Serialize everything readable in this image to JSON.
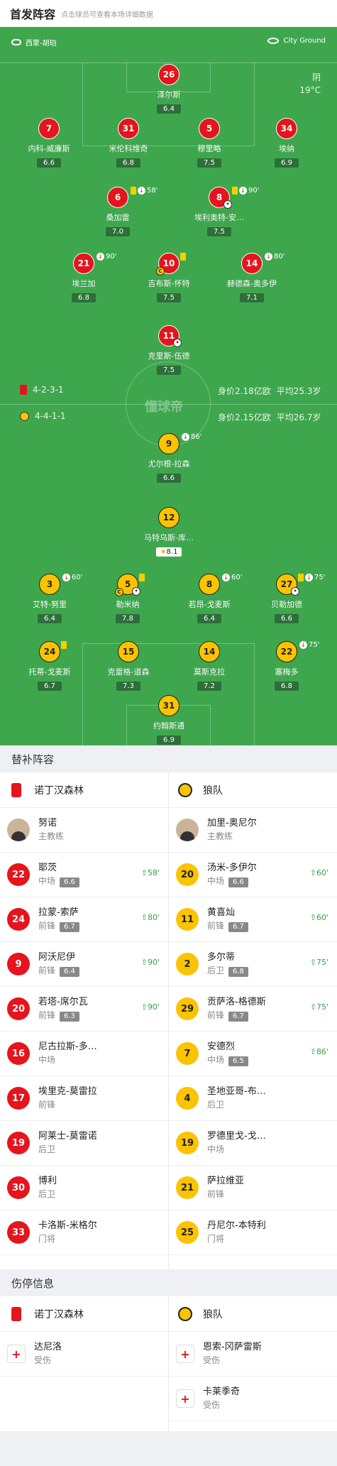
{
  "header": {
    "title": "首发阵容",
    "subtitle": "点击球员可查看本场详细数据"
  },
  "venue": {
    "left": "西蒙-胡珀",
    "right": "City Ground"
  },
  "weather": {
    "condition": "阴",
    "temperature": "19°C"
  },
  "home_team": {
    "formation": "4-2-3-1",
    "value": "身价2.18亿欧",
    "avg_age": "平均25.3岁"
  },
  "away_team": {
    "formation": "4-4-1-1",
    "value": "身价2.15亿欧",
    "avg_age": "平均26.7岁"
  },
  "home_players": [
    {
      "num": "26",
      "name": "泽尔斯",
      "rating": "6.4"
    },
    {
      "num": "7",
      "name": "内科-威廉斯",
      "rating": "6.6"
    },
    {
      "num": "31",
      "name": "米伦科维奇",
      "rating": "6.8"
    },
    {
      "num": "5",
      "name": "穆里略",
      "rating": "7.5"
    },
    {
      "num": "34",
      "name": "埃纳",
      "rating": "6.9"
    },
    {
      "num": "6",
      "name": "桑加雷",
      "rating": "7.0",
      "sub": "58'"
    },
    {
      "num": "8",
      "name": "埃利奥特-安…",
      "rating": "7.5",
      "sub": "90'"
    },
    {
      "num": "21",
      "name": "埃兰加",
      "rating": "6.8",
      "sub": "90'"
    },
    {
      "num": "10",
      "name": "吉布斯-怀特",
      "rating": "7.5"
    },
    {
      "num": "14",
      "name": "赫德森-奥多伊",
      "rating": "7.1",
      "sub": "80'"
    },
    {
      "num": "11",
      "name": "克里斯-伍德",
      "rating": "7.5"
    }
  ],
  "away_players": [
    {
      "num": "9",
      "name": "尤尔根-拉森",
      "rating": "6.6",
      "sub": "86'"
    },
    {
      "num": "12",
      "name": "马特乌斯-库…",
      "rating": "8.1"
    },
    {
      "num": "3",
      "name": "艾特-努里",
      "rating": "6.4",
      "sub": "60'"
    },
    {
      "num": "5",
      "name": "勒米纳",
      "rating": "7.8"
    },
    {
      "num": "8",
      "name": "若昂-戈麦斯",
      "rating": "6.4",
      "sub": "60'"
    },
    {
      "num": "27",
      "name": "贝勒加德",
      "rating": "6.6",
      "sub": "75'"
    },
    {
      "num": "24",
      "name": "托蒂-戈麦斯",
      "rating": "6.7"
    },
    {
      "num": "15",
      "name": "克雷格-道森",
      "rating": "7.3"
    },
    {
      "num": "14",
      "name": "莫斯克拉",
      "rating": "7.2"
    },
    {
      "num": "22",
      "name": "塞梅多",
      "rating": "6.8",
      "sub": "75'"
    },
    {
      "num": "31",
      "name": "约翰斯通",
      "rating": "6.9"
    }
  ],
  "watermark": "懂球帝",
  "subs_section": {
    "title": "替补阵容",
    "home_team": "诺丁汉森林",
    "away_team": "狼队",
    "home_coach": {
      "name": "努诺",
      "role": "主教练"
    },
    "away_coach": {
      "name": "加里-奥尼尔",
      "role": "主教练"
    },
    "home": [
      {
        "num": "22",
        "name": "耶茨",
        "pos": "中场",
        "rating": "6.6",
        "in": "58'"
      },
      {
        "num": "24",
        "name": "拉蒙-索萨",
        "pos": "前锋",
        "rating": "6.7",
        "in": "80'"
      },
      {
        "num": "9",
        "name": "阿沃尼伊",
        "pos": "前锋",
        "rating": "6.4",
        "in": "90'"
      },
      {
        "num": "20",
        "name": "若塔-席尔瓦",
        "pos": "前锋",
        "rating": "6.3",
        "in": "90'"
      },
      {
        "num": "16",
        "name": "尼古拉斯-多…",
        "pos": "中场"
      },
      {
        "num": "17",
        "name": "埃里克-莫雷拉",
        "pos": "前锋"
      },
      {
        "num": "19",
        "name": "阿莱士-莫雷诺",
        "pos": "后卫"
      },
      {
        "num": "30",
        "name": "博利",
        "pos": "后卫"
      },
      {
        "num": "33",
        "name": "卡洛斯-米格尔",
        "pos": "门将"
      }
    ],
    "away": [
      {
        "num": "20",
        "name": "汤米-多伊尔",
        "pos": "中场",
        "rating": "6.6",
        "in": "60'"
      },
      {
        "num": "11",
        "name": "黄喜灿",
        "pos": "前锋",
        "rating": "6.7",
        "in": "60'"
      },
      {
        "num": "2",
        "name": "多尔蒂",
        "pos": "后卫",
        "rating": "6.8",
        "in": "75'"
      },
      {
        "num": "29",
        "name": "贡萨洛-格德斯",
        "pos": "前锋",
        "rating": "6.7",
        "in": "75'"
      },
      {
        "num": "7",
        "name": "安德烈",
        "pos": "中场",
        "rating": "6.5",
        "in": "86'"
      },
      {
        "num": "4",
        "name": "圣地亚哥-布…",
        "pos": "后卫"
      },
      {
        "num": "19",
        "name": "罗德里戈-戈…",
        "pos": "中场"
      },
      {
        "num": "21",
        "name": "萨拉维亚",
        "pos": "前锋"
      },
      {
        "num": "25",
        "name": "丹尼尔-本特利",
        "pos": "门将"
      }
    ]
  },
  "injury_section": {
    "title": "伤停信息",
    "home_team": "诺丁汉森林",
    "away_team": "狼队",
    "home": [
      {
        "name": "达尼洛",
        "status": "受伤"
      }
    ],
    "away": [
      {
        "name": "恩索-冈萨雷斯",
        "status": "受伤"
      },
      {
        "name": "卡莱季奇",
        "status": "受伤"
      }
    ]
  }
}
